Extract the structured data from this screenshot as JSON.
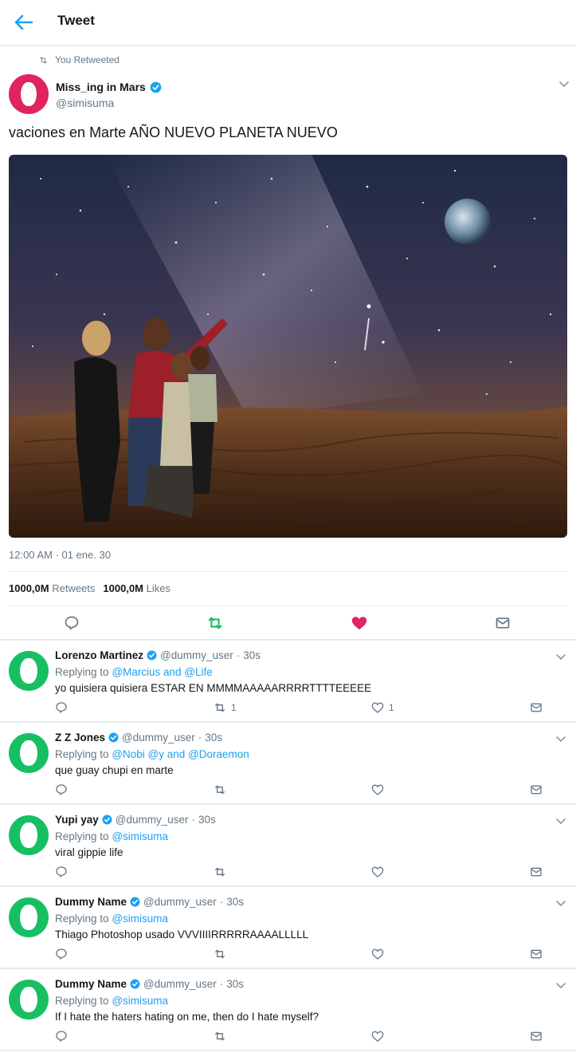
{
  "header": {
    "title": "Tweet",
    "back_icon": "arrow-left-icon"
  },
  "tweet": {
    "retweet_note": "You Retweeted",
    "author_name": "Miss_ing in Mars",
    "author_handle": "@simisuma",
    "text": "vaciones en Marte AÑO NUEVO PLANETA NUEVO",
    "timestamp": "12:00 AM · 01 ene. 30",
    "retweets_count": "1000,0M",
    "retweets_label": "Retweets",
    "likes_count": "1000,0M",
    "likes_label": "Likes",
    "liked": true,
    "retweeted": true
  },
  "replies": [
    {
      "name": "Lorenzo Martinez",
      "handle": "@dummy_user",
      "time": "30s",
      "replying_prefix": "Replying to",
      "replying_to": "@Marcius and @Life",
      "text": "yo quisiera quisiera ESTAR EN MMMMAAAAARRRRTTTTEEEEE",
      "retweets": "1",
      "likes": "1"
    },
    {
      "name": "Z Z Jones",
      "handle": "@dummy_user",
      "time": "30s",
      "replying_prefix": "Replying to",
      "replying_to": "@Nobi @y and @Doraemon",
      "text": "que guay chupi en marte",
      "retweets": "",
      "likes": ""
    },
    {
      "name": "Yupi yay",
      "handle": "@dummy_user",
      "time": "30s",
      "replying_prefix": "Replying to",
      "replying_to": "@simisuma",
      "text": "viral gippie life",
      "retweets": "",
      "likes": ""
    },
    {
      "name": "Dummy Name",
      "handle": "@dummy_user",
      "time": "30s",
      "replying_prefix": "Replying to",
      "replying_to": "@simisuma",
      "text": "Thiago Photoshop usado VVVIIIIRRRRRAAAALLLLL",
      "retweets": "",
      "likes": ""
    },
    {
      "name": "Dummy Name",
      "handle": "@dummy_user",
      "time": "30s",
      "replying_prefix": "Replying to",
      "replying_to": "@simisuma",
      "text": "If I hate the haters hating on me, then do I hate myself?",
      "retweets": "",
      "likes": ""
    }
  ],
  "colors": {
    "accent": "#1da1f2",
    "like": "#e0245e",
    "retweet": "#17bf63",
    "muted": "#657786",
    "divider": "#e6ecf0"
  }
}
